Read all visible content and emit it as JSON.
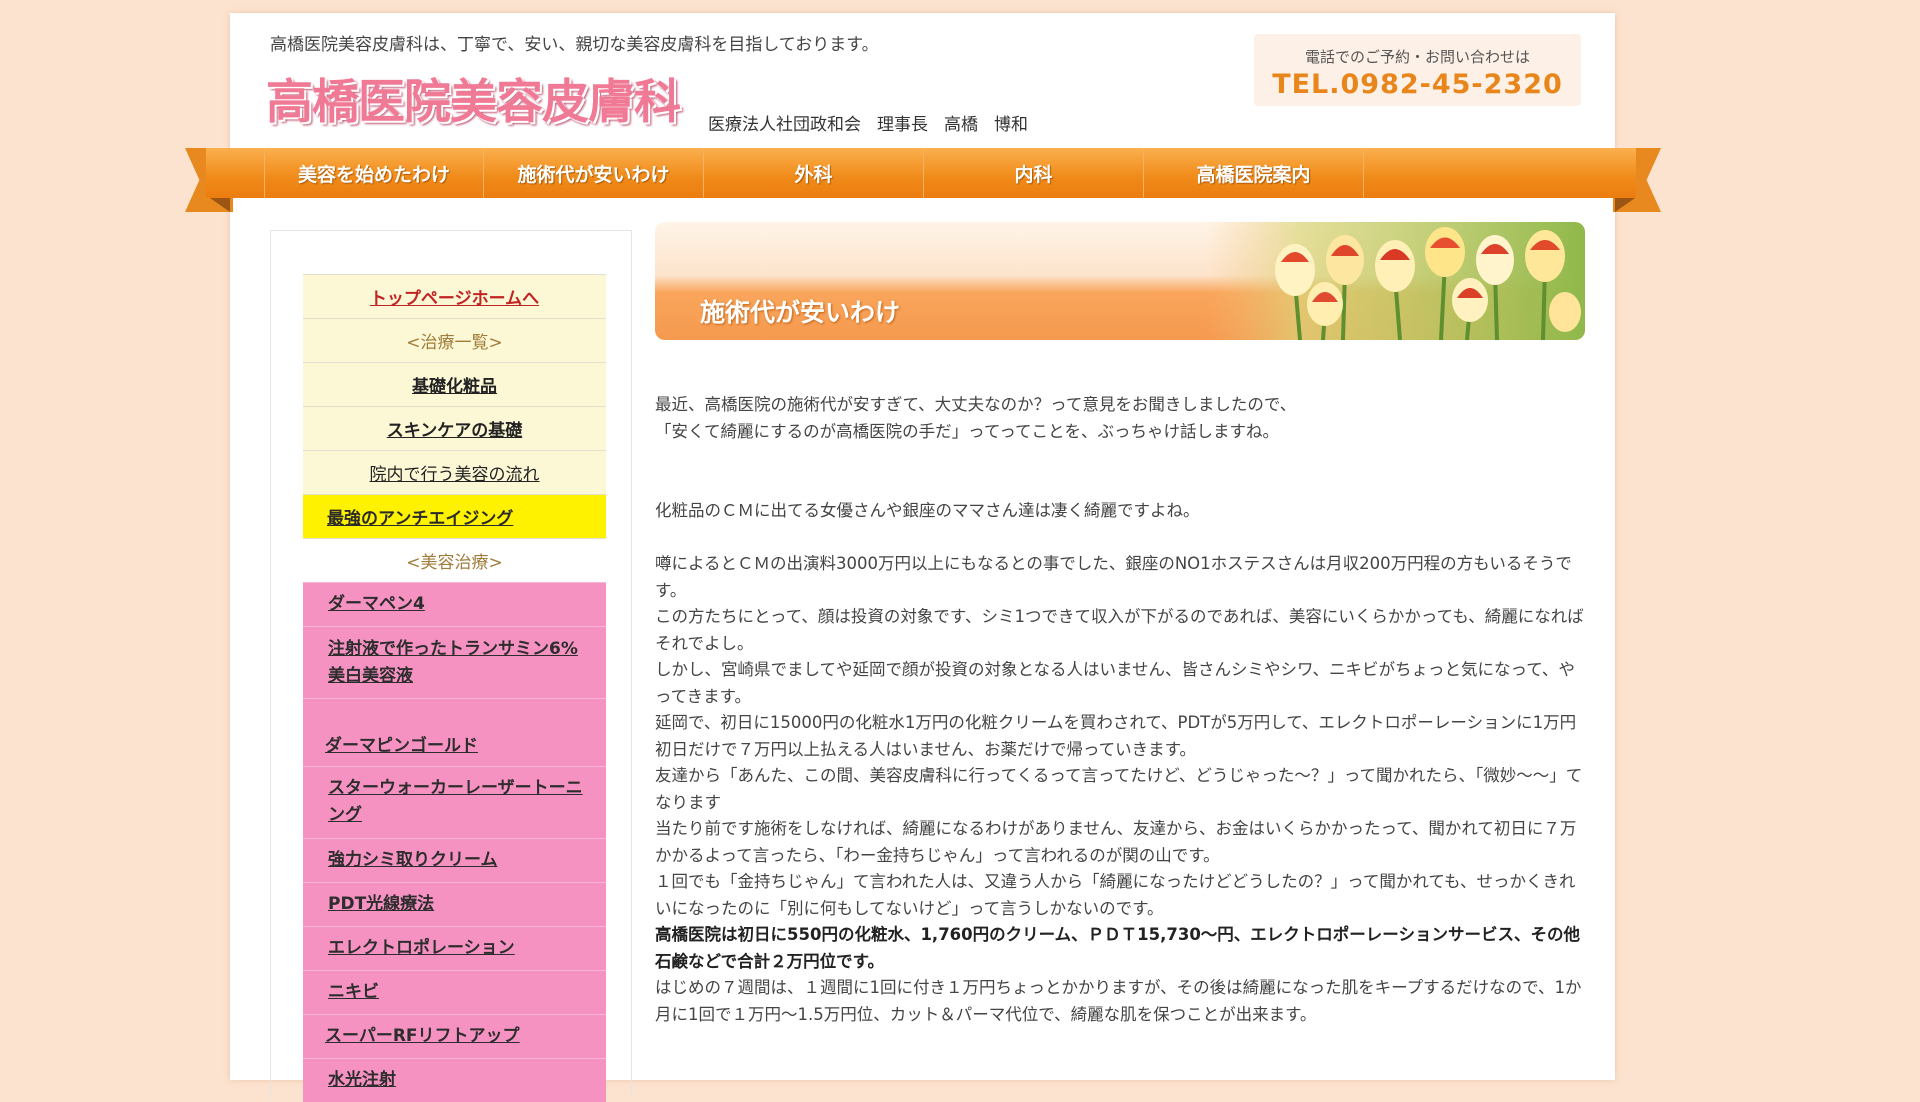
{
  "header": {
    "tagline": "高橋医院美容皮膚科は、丁寧で、安い、親切な美容皮膚科を目指しております。",
    "logo_text": "高橋医院美容皮膚科",
    "director": {
      "org": "医療法人社団政和会",
      "title": "理事長",
      "surname": "高橋",
      "given_name": "博和"
    },
    "contact_caption": "電話でのご予約・お問い合わせは",
    "phone": "TEL.0982-45-2320"
  },
  "nav": {
    "items": [
      {
        "label": "美容を始めたわけ"
      },
      {
        "label": "施術代が安いわけ"
      },
      {
        "label": "外科"
      },
      {
        "label": "内科"
      },
      {
        "label": "高橋医院案内"
      }
    ]
  },
  "sidebar": {
    "top_link": "トップページホームへ",
    "category_treatments": "<治療一覧>",
    "treatments": [
      {
        "label": "基礎化粧品"
      },
      {
        "label": "スキンケアの基礎"
      },
      {
        "label": "院内で行う美容の流れ"
      }
    ],
    "highlight": "最強のアンチエイジング",
    "category_beauty": "<美容治療>",
    "beauty_items": [
      {
        "label": "ダーマペン4"
      },
      {
        "label": "注射液で作ったトランサミン6%美白美容液"
      },
      {
        "label": "ダーマピンゴールド"
      },
      {
        "label": "スターウォーカーレーザートーニング"
      },
      {
        "label": "強力シミ取りクリーム"
      },
      {
        "label": "PDT光線療法"
      },
      {
        "label": "エレクトロポレーション"
      },
      {
        "label": "ニキビ"
      },
      {
        "label": "スーパーRFリフトアップ"
      },
      {
        "label": "水光注射"
      }
    ]
  },
  "main": {
    "banner_title": "施術代が安いわけ",
    "intro": [
      "最近、高橋医院の施術代が安すぎて、大丈夫なのか？って意見をお聞きしましたので、",
      "「安くて綺麗にするのが高橋医院の手だ」ってってことを、ぶっちゃけ話しますね。"
    ],
    "para1": "化粧品のＣＭに出てる女優さんや銀座のママさん達は凄く綺麗ですよね。",
    "body": [
      "噂によるとＣＭの出演料3000万円以上にもなるとの事でした、銀座のNO1ホステスさんは月収200万円程の方もいるそうです。",
      "この方たちにとって、顔は投資の対象です、シミ1つできて収入が下がるのであれば、美容にいくらかかっても、綺麗になればそれでよし。",
      "しかし、宮崎県でましてや延岡で顔が投資の対象となる人はいません、皆さんシミやシワ、ニキビがちょっと気になって、やってきます。",
      "延岡で、初日に15000円の化粧水1万円の化粧クリームを買わされて、PDTが5万円して、エレクトロポーレーションに1万円初日だけで７万円以上払える人はいません、お薬だけで帰っていきます。",
      "友達から「あんた、この間、美容皮膚科に行ってくるって言ってたけど、どうじゃった〜？」って聞かれたら、「微妙〜〜」てなります",
      "当たり前です施術をしなければ、綺麗になるわけがありません、友達から、お金はいくらかかったって、聞かれて初日に７万かかるよって言ったら、「わー金持ちじゃん」って言われるのが関の山です。",
      "１回でも「金持ちじゃん」て言われた人は、又違う人から「綺麗になったけどどうしたの？」って聞かれても、せっかくきれいになったのに「別に何もしてないけど」って言うしかないのです。"
    ],
    "bold_statement": "高橋医院は初日に550円の化粧水、1,760円のクリーム、ＰＤＴ15,730〜円、エレクトロポーレーションサービス、その他石鹸などで合計２万円位です。",
    "closing": "はじめの７週間は、１週間に1回に付き１万円ちょっとかかりますが、その後は綺麗になった肌をキープするだけなので、1か月に1回で１万円〜1.5万円位、カット＆パーマ代位で、綺麗な肌を保つことが出来ます。"
  },
  "colors": {
    "background": "#fce3cf",
    "nav_orange": "#f08a18",
    "phone_orange": "#e8861c",
    "logo_pink": "#f07a95",
    "menu_cream": "#fcf8d6",
    "menu_yellow": "#fff200",
    "menu_pink": "#f592c1",
    "link_red": "#c22323"
  }
}
